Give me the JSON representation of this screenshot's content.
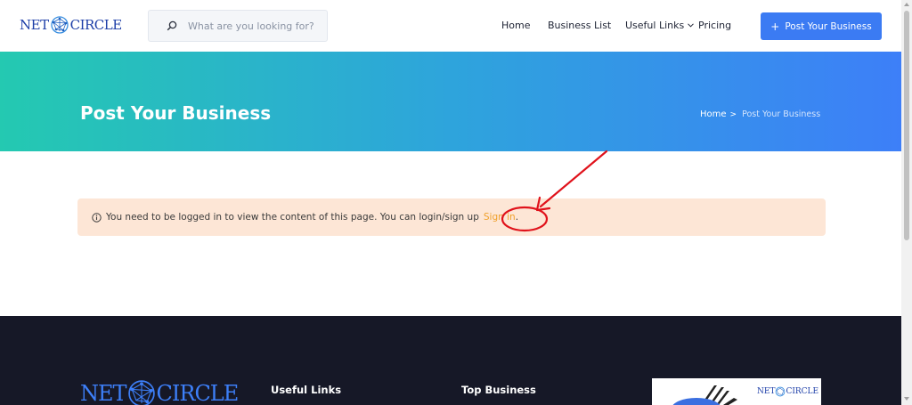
{
  "header": {
    "logo": {
      "left": "NET",
      "right": "CIRCLE"
    },
    "search": {
      "placeholder": "What are you looking for?",
      "value": ""
    },
    "nav": [
      {
        "label": "Home"
      },
      {
        "label": "Business List"
      },
      {
        "label": "Useful Links"
      },
      {
        "label": "Pricing"
      }
    ],
    "post_button": {
      "label": "Post Your Business"
    }
  },
  "hero": {
    "title": "Post Your Business",
    "breadcrumb": {
      "home": "Home",
      "separator": ">",
      "current": "Post Your Business"
    }
  },
  "notice": {
    "message": "You need to be logged in to view the content of this page. You can login/sign up",
    "link_label": "Sign in",
    "suffix": "."
  },
  "footer": {
    "logo": {
      "left": "NET",
      "right": "CIRCLE"
    },
    "useful_links_heading": "Useful Links",
    "top_business_heading": "Top Business",
    "card_logo": {
      "left": "NET",
      "right": "CIRCLE"
    }
  },
  "colors": {
    "accent": "#3b7bf3",
    "hero_start": "#24c9b1",
    "hero_end": "#3d7ff8",
    "notice_bg": "#fde6d6",
    "link": "#f0a02a",
    "annotation": "#e0121b",
    "footer_bg": "#161827"
  },
  "icons": {
    "search": "search-icon",
    "info": "info-icon",
    "chevron": "chevron-down-icon",
    "plus": "plus-icon",
    "globe": "globe-network-icon"
  }
}
